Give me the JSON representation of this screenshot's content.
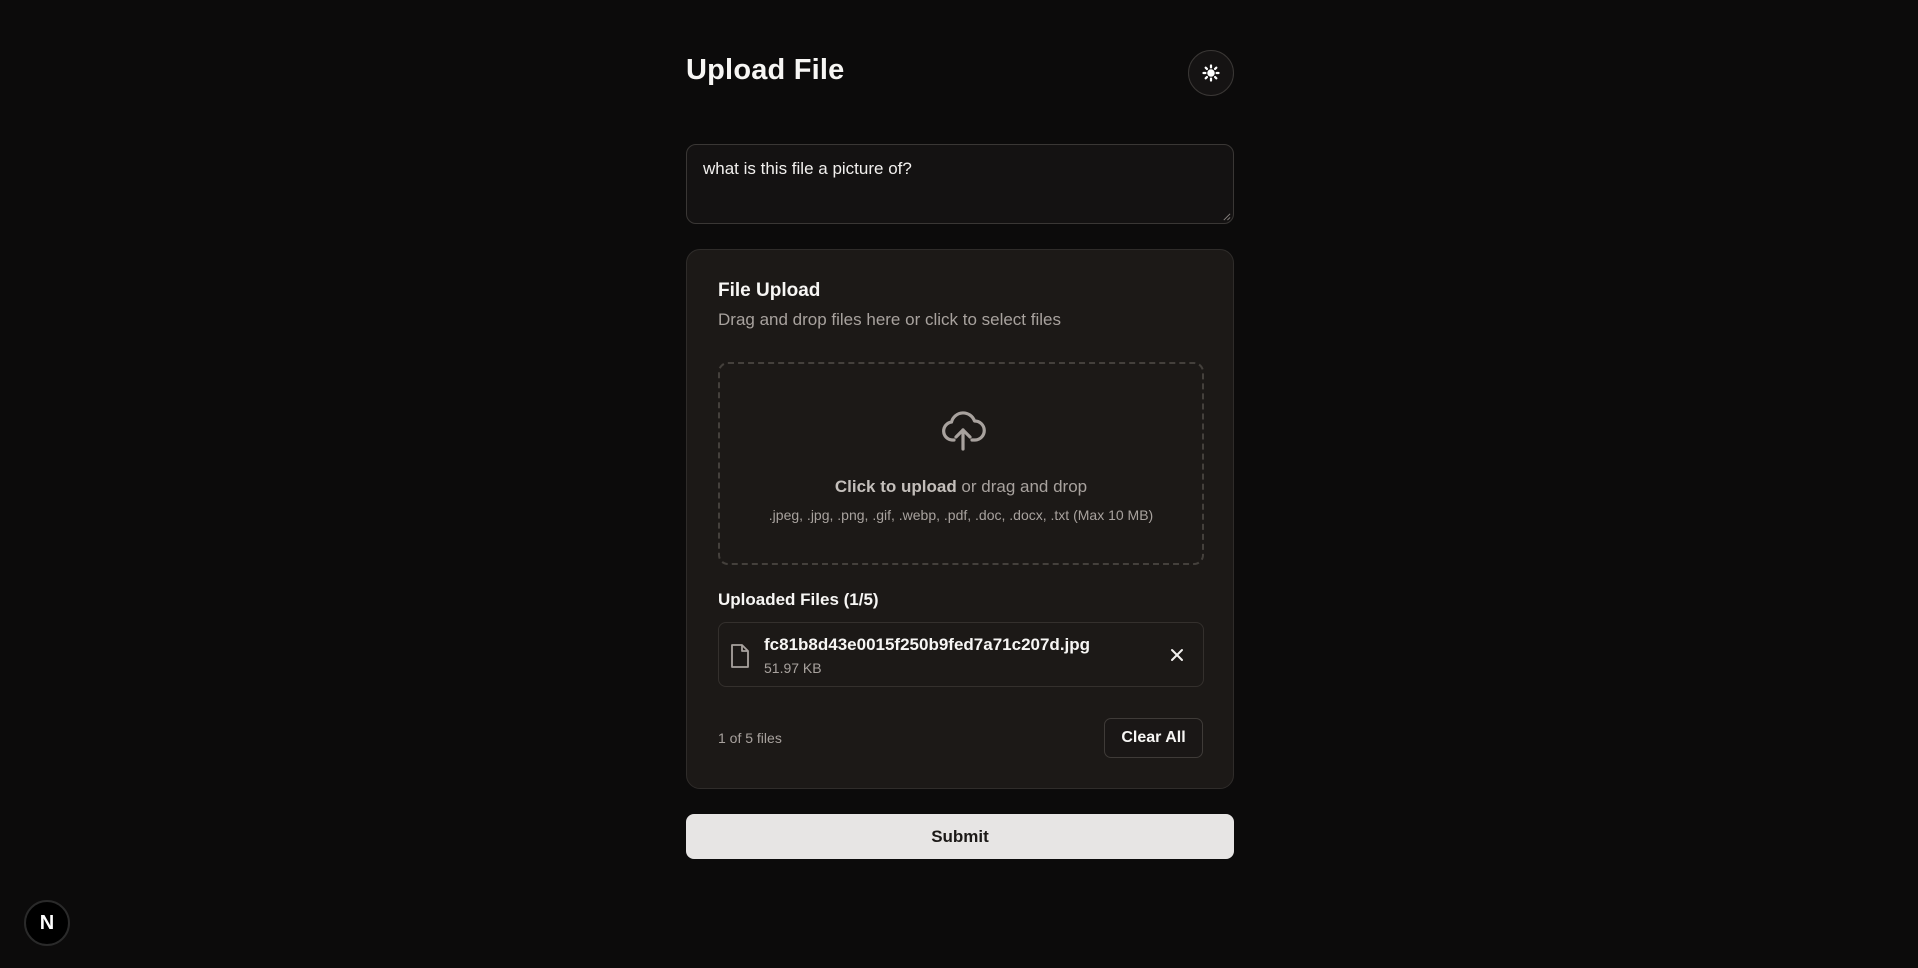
{
  "page": {
    "title": "Upload File"
  },
  "header": {
    "theme_toggle_icon": "sun-icon"
  },
  "prompt": {
    "value": "what is this file a picture of?"
  },
  "upload_card": {
    "title": "File Upload",
    "subtitle": "Drag and drop files here or click to select files",
    "dropzone": {
      "icon": "cloud-upload-icon",
      "click_label": "Click to upload",
      "drag_label": " or drag and drop",
      "accepted_types": ".jpeg, .jpg, .png, .gif, .webp, .pdf, .doc, .docx, .txt (Max 10 MB)"
    },
    "uploaded_heading": "Uploaded Files (1/5)",
    "files": [
      {
        "name": "fc81b8d43e0015f250b9fed7a71c207d.jpg",
        "size": "51.97 KB",
        "icon": "file-icon"
      }
    ],
    "file_count": "1 of 5 files",
    "clear_all_label": "Clear All"
  },
  "submit": {
    "label": "Submit"
  },
  "dev_badge": {
    "label": "N"
  },
  "colors": {
    "background": "#0c0b0b",
    "card": "#1c1917",
    "muted_text": "#a8a29e",
    "submit_bg": "#e7e5e4"
  }
}
